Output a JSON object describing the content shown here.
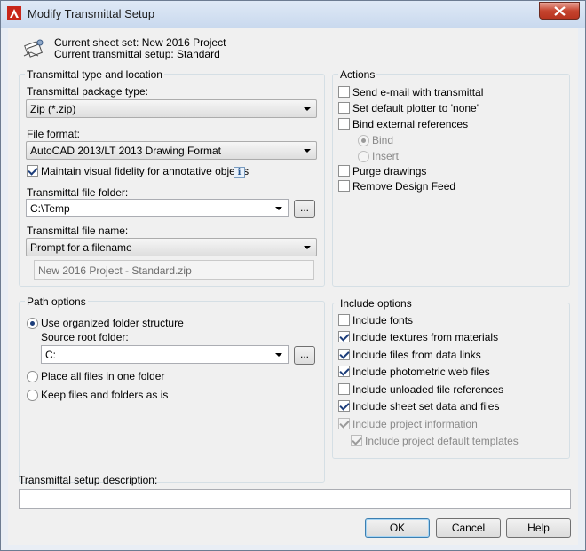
{
  "window": {
    "title": "Modify Transmittal Setup",
    "close_glyph": "✕"
  },
  "header": {
    "sheet_set_line": "Current sheet set: New 2016 Project",
    "setup_line": "Current transmittal setup: Standard",
    "icon": "transmittal-package-icon"
  },
  "transmittal": {
    "group_title": "Transmittal type and location",
    "package_type_label": "Transmittal package type:",
    "package_type_value": "Zip (*.zip)",
    "file_format_label": "File format:",
    "file_format_value": "AutoCAD 2013/LT 2013 Drawing Format",
    "maintain_fidelity_label": "Maintain visual fidelity for annotative objects",
    "maintain_fidelity_checked": true,
    "info_glyph": "i",
    "folder_label": "Transmittal file folder:",
    "folder_value": "C:\\Temp",
    "browse_label": "...",
    "file_name_label": "Transmittal file name:",
    "file_name_value": "Prompt for a filename",
    "file_name_preview": "New 2016 Project - Standard.zip"
  },
  "path_options": {
    "group_title": "Path options",
    "organized_label": "Use organized folder structure",
    "source_root_label": "Source root folder:",
    "source_root_value": "C:",
    "browse_label": "...",
    "all_in_one_label": "Place all files in one folder",
    "keep_as_is_label": "Keep files and folders as is",
    "selected": "organized"
  },
  "actions": {
    "group_title": "Actions",
    "send_email": {
      "label": "Send e-mail with transmittal",
      "checked": false
    },
    "default_plotter": {
      "label": "Set default plotter to 'none'",
      "checked": false
    },
    "bind_xrefs": {
      "label": "Bind external references",
      "checked": false
    },
    "bind": {
      "label": "Bind",
      "selected": true,
      "enabled": false
    },
    "insert": {
      "label": "Insert",
      "selected": false,
      "enabled": false
    },
    "purge": {
      "label": "Purge drawings",
      "checked": false
    },
    "remove_design_feed": {
      "label": "Remove Design Feed",
      "checked": false
    }
  },
  "include_options": {
    "group_title": "Include options",
    "fonts": {
      "label": "Include fonts",
      "checked": false
    },
    "textures": {
      "label": "Include textures from materials",
      "checked": true
    },
    "data_links": {
      "label": "Include files from data links",
      "checked": true
    },
    "photometric": {
      "label": "Include photometric web files",
      "checked": true
    },
    "unloaded_refs": {
      "label": "Include unloaded file references",
      "checked": false
    },
    "sheet_set_data": {
      "label": "Include sheet set data and files",
      "checked": true
    },
    "project_info": {
      "label": "Include project information",
      "checked": true,
      "enabled": false
    },
    "project_templates": {
      "label": "Include project default templates",
      "checked": true,
      "enabled": false
    }
  },
  "description": {
    "label": "Transmittal setup description:",
    "value": ""
  },
  "buttons": {
    "ok": "OK",
    "cancel": "Cancel",
    "help": "Help"
  },
  "colors": {
    "title_bar": "#c9d9ee",
    "close_button": "#c6452f",
    "dialog_bg": "#f0f0f0",
    "check_mark": "#1c3d7a"
  }
}
